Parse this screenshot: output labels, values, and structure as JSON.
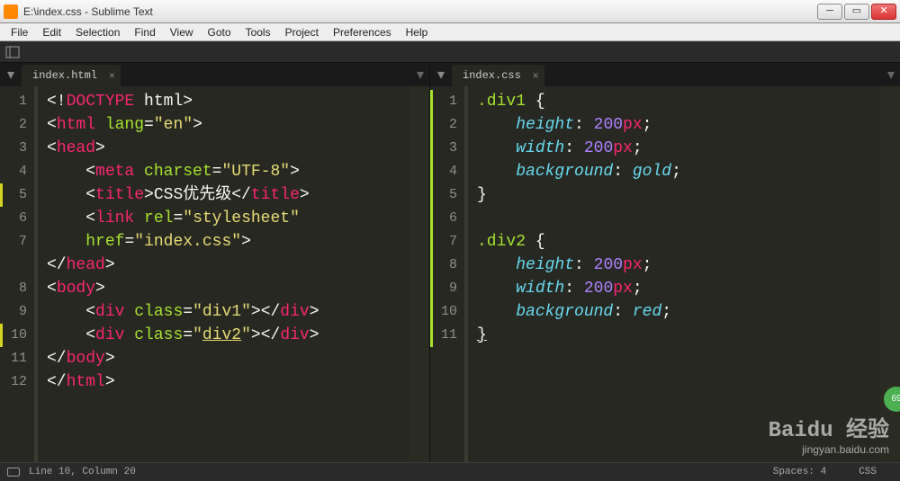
{
  "window": {
    "title": "E:\\index.css - Sublime Text"
  },
  "menu": [
    "File",
    "Edit",
    "Selection",
    "Find",
    "View",
    "Goto",
    "Tools",
    "Project",
    "Preferences",
    "Help"
  ],
  "left": {
    "tab": "index.html",
    "lines": [
      "1",
      "2",
      "3",
      "4",
      "5",
      "6",
      "7",
      "8",
      "9",
      "10",
      "11",
      "12"
    ]
  },
  "right": {
    "tab": "index.css",
    "lines": [
      "1",
      "2",
      "3",
      "4",
      "5",
      "6",
      "7",
      "8",
      "9",
      "10",
      "11"
    ]
  },
  "status": {
    "pos": "Line 10, Column 20",
    "spaces": "Spaces: 4",
    "lang": "CSS"
  },
  "wm": {
    "big": "Baidu 经验",
    "small": "jingyan.baidu.com"
  },
  "badge": "69"
}
